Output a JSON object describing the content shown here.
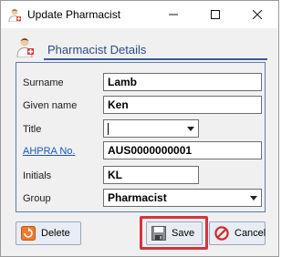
{
  "window": {
    "title": "Update Pharmacist",
    "icon": "pharmacist-avatar-icon"
  },
  "header": {
    "title": "Pharmacist Details",
    "icon": "pharmacist-avatar-icon"
  },
  "form": {
    "surname": {
      "label": "Surname",
      "value": "Lamb"
    },
    "given_name": {
      "label": "Given name",
      "value": "Ken"
    },
    "title": {
      "label": "Title",
      "value": ""
    },
    "ahpra": {
      "label": "AHPRA No.",
      "value": "AUS0000000001"
    },
    "initials": {
      "label": "Initials",
      "value": "KL"
    },
    "group": {
      "label": "Group",
      "value": "Pharmacist"
    }
  },
  "buttons": {
    "delete": "Delete",
    "save": "Save",
    "cancel": "Cancel"
  },
  "colors": {
    "highlight": "#d6333c",
    "header_text": "#2c4c86",
    "link": "#1a56c4"
  }
}
